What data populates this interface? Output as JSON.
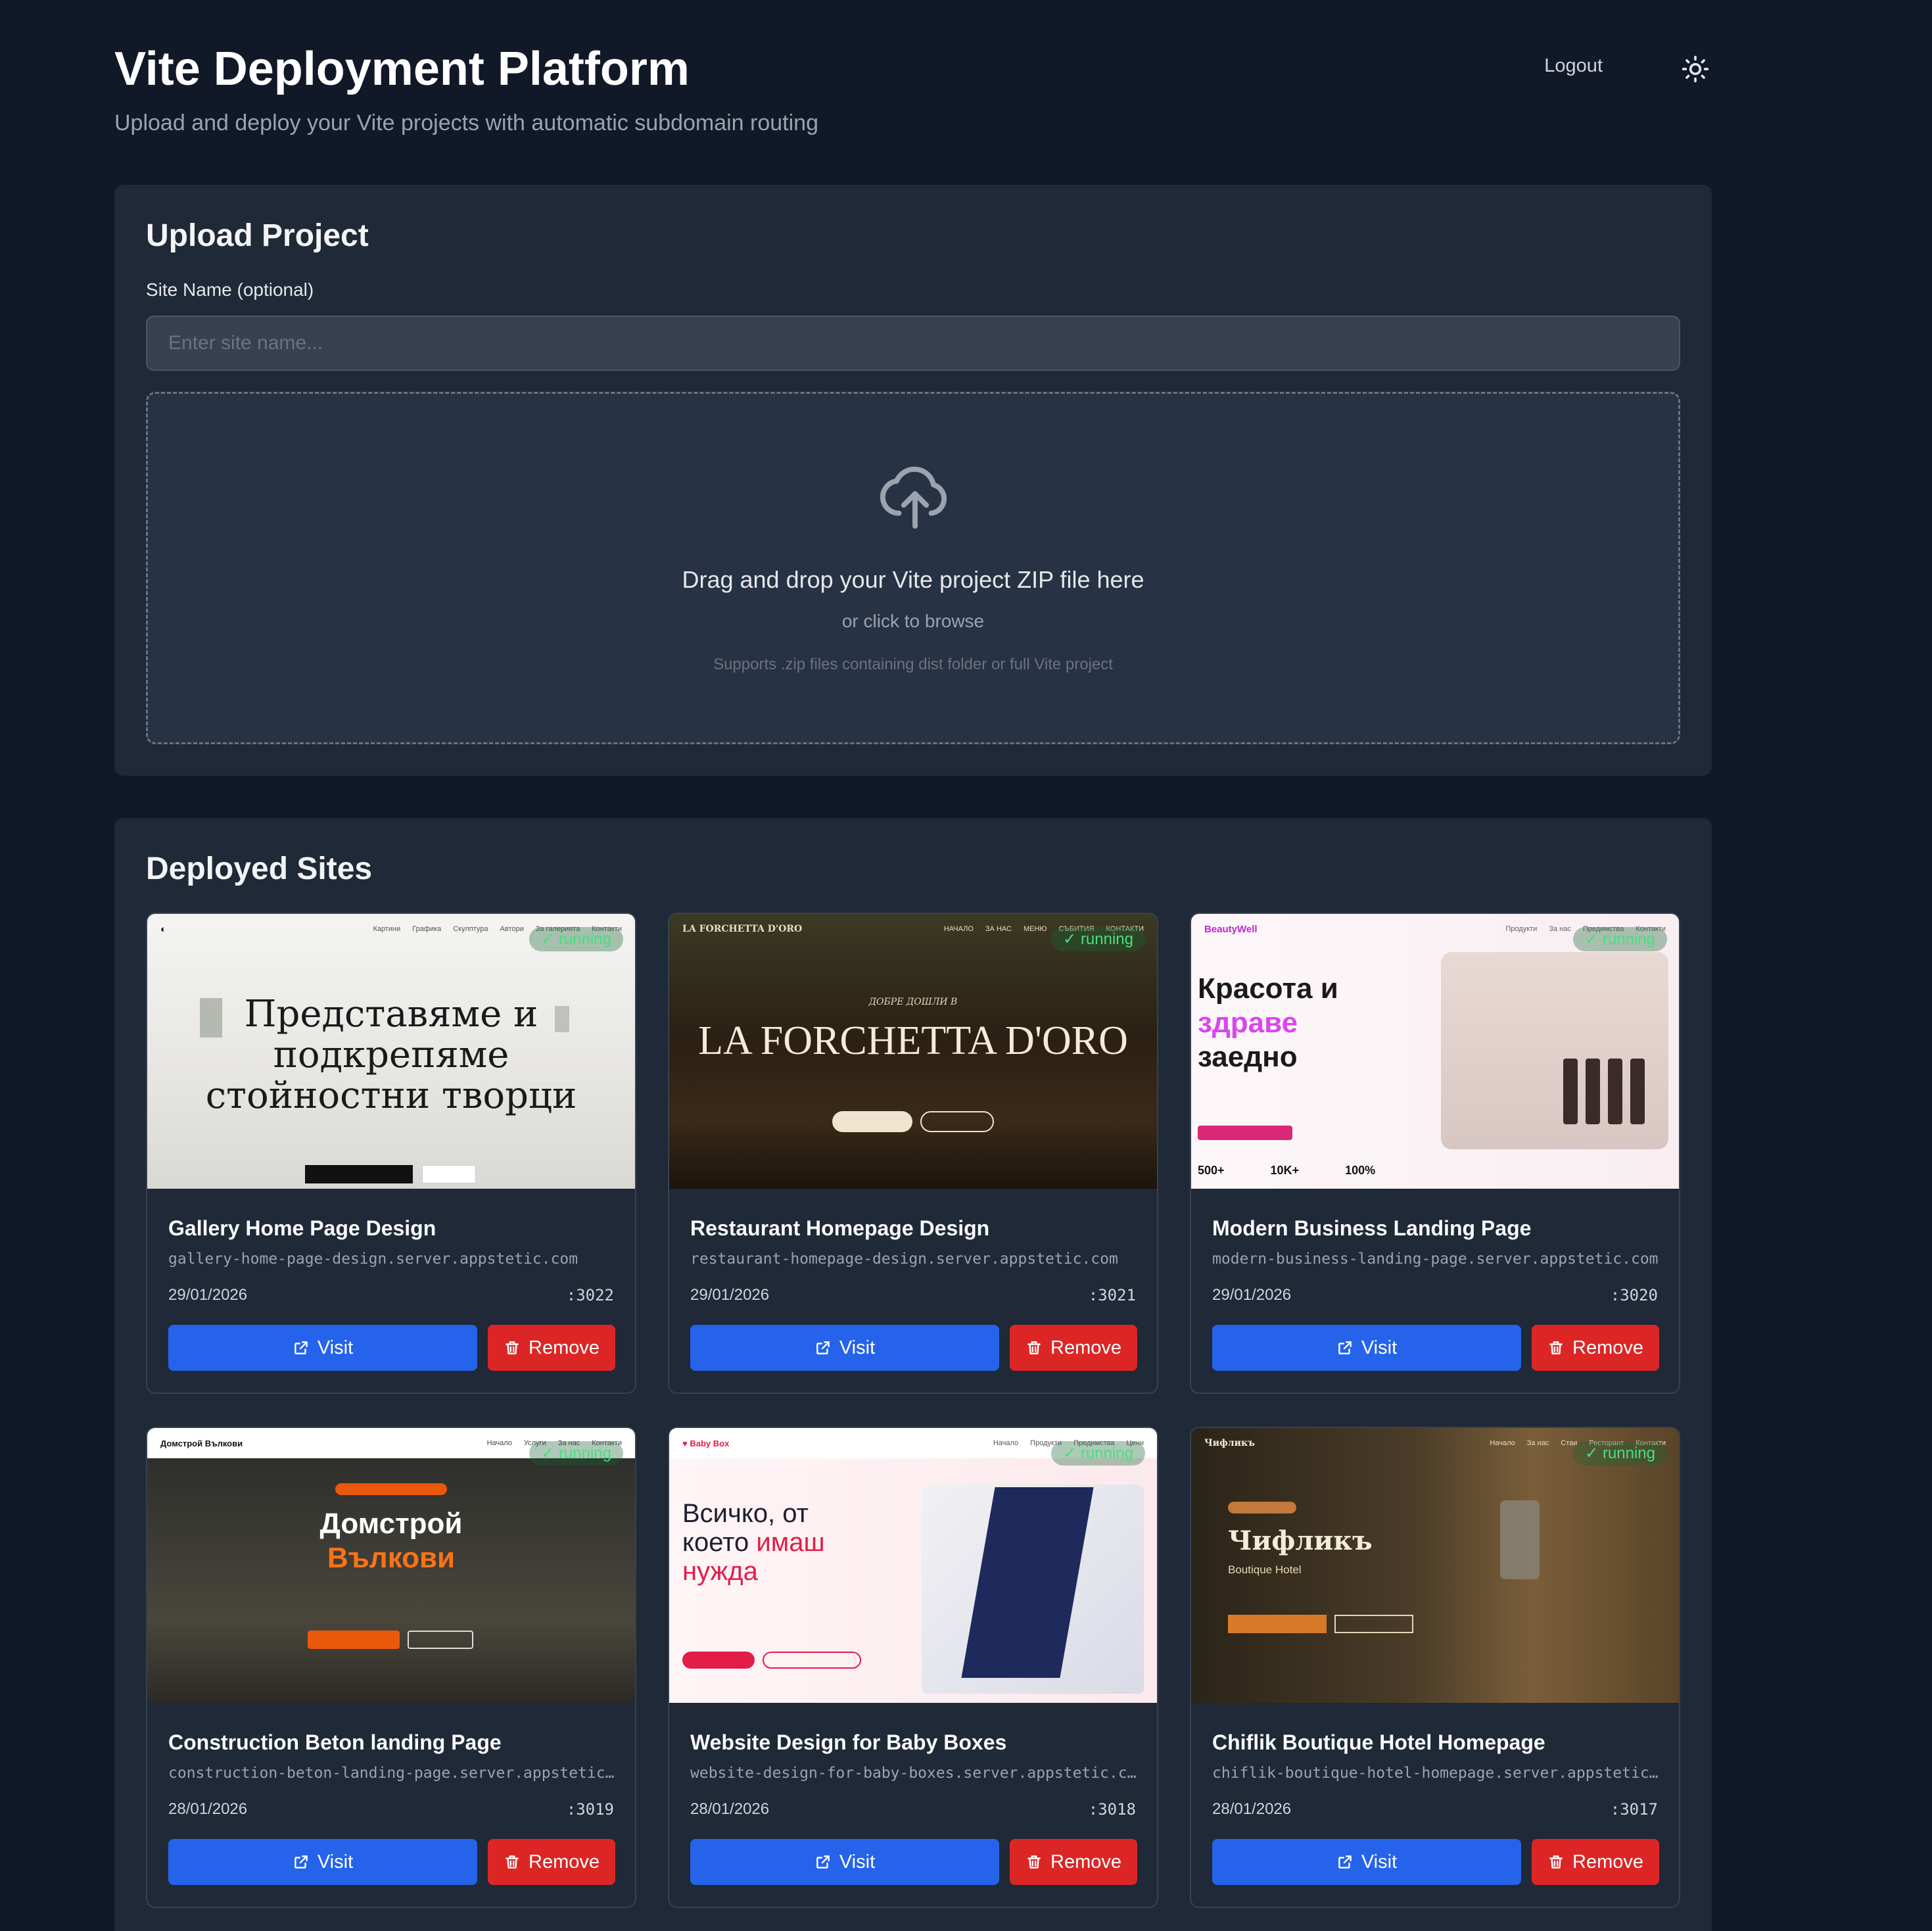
{
  "header": {
    "title": "Vite Deployment Platform",
    "subtitle": "Upload and deploy your Vite projects with automatic subdomain routing",
    "logout_label": "Logout"
  },
  "upload": {
    "title": "Upload Project",
    "field_label": "Site Name (optional)",
    "placeholder": "Enter site name...",
    "dropzone_main": "Drag and drop your Vite project ZIP file here",
    "dropzone_sub": "or click to browse",
    "dropzone_hint": "Supports .zip files containing dist folder or full Vite project"
  },
  "sites": {
    "title": "Deployed Sites",
    "visit_label": "Visit",
    "remove_label": "Remove",
    "status_label": "running",
    "items": [
      {
        "name": "Gallery Home Page Design",
        "url": "gallery-home-page-design.server.appstetic.com",
        "date": "29/01/2026",
        "port": ":3022"
      },
      {
        "name": "Restaurant Homepage Design",
        "url": "restaurant-homepage-design.server.appstetic.com",
        "date": "29/01/2026",
        "port": ":3021"
      },
      {
        "name": "Modern Business Landing Page",
        "url": "modern-business-landing-page.server.appstetic.com",
        "date": "29/01/2026",
        "port": ":3020"
      },
      {
        "name": "Construction Beton landing Page",
        "url": "construction-beton-landing-page.server.appstetic.com",
        "date": "28/01/2026",
        "port": ":3019"
      },
      {
        "name": "Website Design for Baby Boxes",
        "url": "website-design-for-baby-boxes.server.appstetic.com",
        "date": "28/01/2026",
        "port": ":3018"
      },
      {
        "name": "Chiflik Boutique Hotel Homepage",
        "url": "chiflik-boutique-hotel-homepage.server.appstetic.com",
        "date": "28/01/2026",
        "port": ":3017"
      }
    ]
  },
  "thumbnails": {
    "gallery": {
      "headline": "Представяме и подкрепяме стойностни творци"
    },
    "restaurant": {
      "brand": "LA FORCHETTA D'ORO",
      "headline": "LA FORCHETTA D'ORO",
      "kicker": "ДОБРЕ ДОШЛИ В"
    },
    "business": {
      "brand": "BeautyWell",
      "line1": "Красота и",
      "line2": "здраве",
      "line3": "заедно",
      "stat1": "500+",
      "stat2": "10K+",
      "stat3": "100%"
    },
    "construction": {
      "brand": "Домстрой Вълкови",
      "line1": "Домстрой",
      "line2": "Вълкови"
    },
    "baby": {
      "brand": "Baby Box",
      "line1": "Всичко, от",
      "line2": "което",
      "line2b": "имаш",
      "line3": "нужда"
    },
    "hotel": {
      "brand": "Чифликъ",
      "headline": "Чифликъ",
      "sub": "Boutique Hotel"
    }
  },
  "colors": {
    "background": "#111827",
    "panel": "#1f2937",
    "visit": "#2563eb",
    "remove": "#dc2626",
    "running": "#4ade80"
  }
}
